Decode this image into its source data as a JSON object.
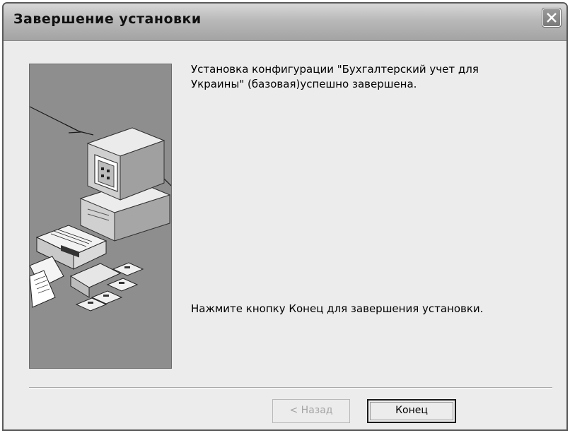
{
  "window": {
    "title": "Завершение установки"
  },
  "content": {
    "message": "Установка конфигурации \"Бухгалтерский учет для Украины\" (базовая)успешно завершена.",
    "instruction": "Нажмите кнопку Конец для завершения установки."
  },
  "buttons": {
    "back_label": "< Назад",
    "back_enabled": false,
    "finish_label": "Конец"
  },
  "icons": {
    "close": "close-icon",
    "illustration": "computer-setup-illustration"
  }
}
